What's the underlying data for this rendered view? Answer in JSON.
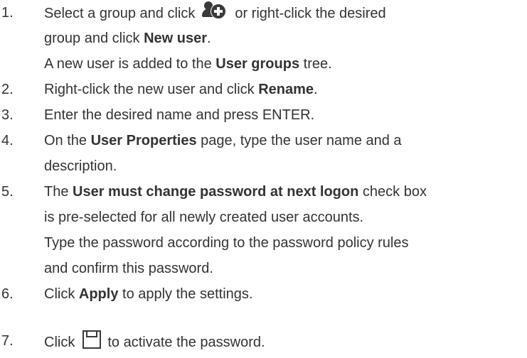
{
  "steps": [
    {
      "num": "1.",
      "lines": [
        {
          "pre": "Select a group and click",
          "post": "or right-click the desired"
        },
        {
          "text": "group and click ",
          "bold": "New user",
          "tail": "."
        },
        {
          "text": "A new user is added to the ",
          "bold": "User groups",
          "tail": " tree."
        }
      ]
    },
    {
      "num": "2.",
      "lines": [
        {
          "text": "Right-click the new user and click ",
          "bold": "Rename",
          "tail": "."
        }
      ]
    },
    {
      "num": "3.",
      "lines": [
        {
          "text": "Enter the desired name and press ENTER."
        }
      ]
    },
    {
      "num": "4.",
      "lines": [
        {
          "text": "On the ",
          "bold": "User Properties",
          "tail": " page, type the user name and a"
        },
        {
          "text": "description."
        }
      ]
    },
    {
      "num": "5.",
      "lines": [
        {
          "text": "The ",
          "bold": "User must change password at next logon",
          "tail": " check box"
        },
        {
          "text": "is pre-selected for all newly created user accounts."
        },
        {
          "text": "Type the password according to the password policy rules"
        },
        {
          "text": "and confirm this password."
        }
      ]
    },
    {
      "num": "6.",
      "lines": [
        {
          "text": "Click ",
          "bold": "Apply",
          "tail": " to apply the settings."
        }
      ]
    },
    {
      "num": "7.",
      "lines": [
        {
          "pre": "Click",
          "post": "to activate the password."
        }
      ]
    }
  ],
  "icons": {
    "new_user": "new-user-icon",
    "save": "save-icon"
  }
}
